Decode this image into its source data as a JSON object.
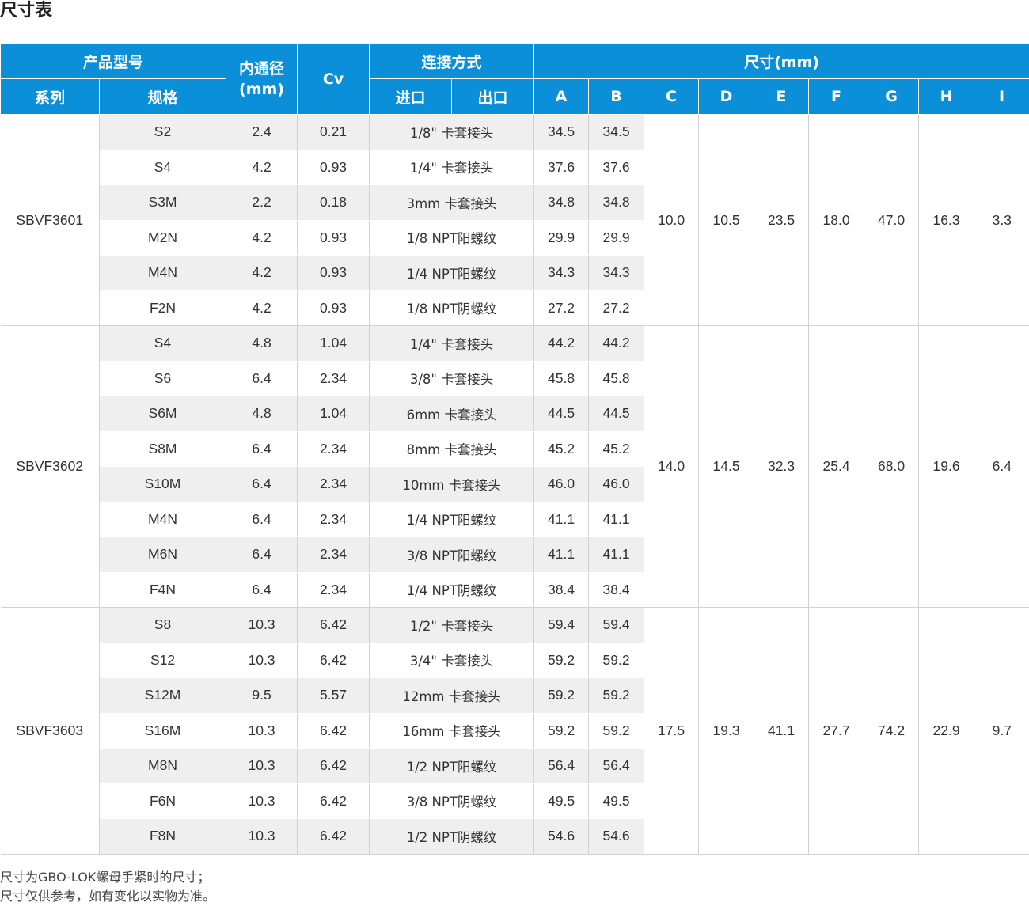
{
  "title": "尺寸表",
  "header": {
    "product_model": "产品型号",
    "series": "系列",
    "spec": "规格",
    "bore": "内通径 (mm)",
    "cv": "Cv",
    "connection": "连接方式",
    "inlet": "进口",
    "outlet": "出口",
    "dimensions": "尺寸(mm)",
    "dim_cols": [
      "A",
      "B",
      "C",
      "D",
      "E",
      "F",
      "G",
      "H",
      "I"
    ]
  },
  "groups": [
    {
      "series": "SBVF3601",
      "C": "10.0",
      "D": "10.5",
      "E": "23.5",
      "F": "18.0",
      "G": "47.0",
      "H": "16.3",
      "I": "3.3",
      "rows": [
        {
          "spec": "S2",
          "bore": "2.4",
          "cv": "0.21",
          "conn": "1/8\" 卡套接头",
          "A": "34.5",
          "B": "34.5"
        },
        {
          "spec": "S4",
          "bore": "4.2",
          "cv": "0.93",
          "conn": "1/4\" 卡套接头",
          "A": "37.6",
          "B": "37.6"
        },
        {
          "spec": "S3M",
          "bore": "2.2",
          "cv": "0.18",
          "conn": "3mm 卡套接头",
          "A": "34.8",
          "B": "34.8"
        },
        {
          "spec": "M2N",
          "bore": "4.2",
          "cv": "0.93",
          "conn": "1/8 NPT阳螺纹",
          "A": "29.9",
          "B": "29.9"
        },
        {
          "spec": "M4N",
          "bore": "4.2",
          "cv": "0.93",
          "conn": "1/4 NPT阳螺纹",
          "A": "34.3",
          "B": "34.3"
        },
        {
          "spec": "F2N",
          "bore": "4.2",
          "cv": "0.93",
          "conn": "1/8 NPT阴螺纹",
          "A": "27.2",
          "B": "27.2"
        }
      ]
    },
    {
      "series": "SBVF3602",
      "C": "14.0",
      "D": "14.5",
      "E": "32.3",
      "F": "25.4",
      "G": "68.0",
      "H": "19.6",
      "I": "6.4",
      "rows": [
        {
          "spec": "S4",
          "bore": "4.8",
          "cv": "1.04",
          "conn": "1/4\" 卡套接头",
          "A": "44.2",
          "B": "44.2"
        },
        {
          "spec": "S6",
          "bore": "6.4",
          "cv": "2.34",
          "conn": "3/8\" 卡套接头",
          "A": "45.8",
          "B": "45.8"
        },
        {
          "spec": "S6M",
          "bore": "4.8",
          "cv": "1.04",
          "conn": "6mm 卡套接头",
          "A": "44.5",
          "B": "44.5"
        },
        {
          "spec": "S8M",
          "bore": "6.4",
          "cv": "2.34",
          "conn": "8mm 卡套接头",
          "A": "45.2",
          "B": "45.2"
        },
        {
          "spec": "S10M",
          "bore": "6.4",
          "cv": "2.34",
          "conn": "10mm 卡套接头",
          "A": "46.0",
          "B": "46.0"
        },
        {
          "spec": "M4N",
          "bore": "6.4",
          "cv": "2.34",
          "conn": "1/4 NPT阳螺纹",
          "A": "41.1",
          "B": "41.1"
        },
        {
          "spec": "M6N",
          "bore": "6.4",
          "cv": "2.34",
          "conn": "3/8 NPT阳螺纹",
          "A": "41.1",
          "B": "41.1"
        },
        {
          "spec": "F4N",
          "bore": "6.4",
          "cv": "2.34",
          "conn": "1/4 NPT阴螺纹",
          "A": "38.4",
          "B": "38.4"
        }
      ]
    },
    {
      "series": "SBVF3603",
      "C": "17.5",
      "D": "19.3",
      "E": "41.1",
      "F": "27.7",
      "G": "74.2",
      "H": "22.9",
      "I": "9.7",
      "rows": [
        {
          "spec": "S8",
          "bore": "10.3",
          "cv": "6.42",
          "conn": "1/2\" 卡套接头",
          "A": "59.4",
          "B": "59.4"
        },
        {
          "spec": "S12",
          "bore": "10.3",
          "cv": "6.42",
          "conn": "3/4\" 卡套接头",
          "A": "59.2",
          "B": "59.2"
        },
        {
          "spec": "S12M",
          "bore": "9.5",
          "cv": "5.57",
          "conn": "12mm 卡套接头",
          "A": "59.2",
          "B": "59.2"
        },
        {
          "spec": "S16M",
          "bore": "10.3",
          "cv": "6.42",
          "conn": "16mm 卡套接头",
          "A": "59.2",
          "B": "59.2"
        },
        {
          "spec": "M8N",
          "bore": "10.3",
          "cv": "6.42",
          "conn": "1/2 NPT阳螺纹",
          "A": "56.4",
          "B": "56.4"
        },
        {
          "spec": "F6N",
          "bore": "10.3",
          "cv": "6.42",
          "conn": "3/8 NPT阴螺纹",
          "A": "49.5",
          "B": "49.5"
        },
        {
          "spec": "F8N",
          "bore": "10.3",
          "cv": "6.42",
          "conn": "1/2 NPT阴螺纹",
          "A": "54.6",
          "B": "54.6"
        }
      ]
    }
  ],
  "notes": [
    "尺寸为GBO-LOK螺母手紧时的尺寸；",
    "尺寸仅供参考，如有变化以实物为准。"
  ],
  "colors": {
    "header_bg": "#0b8fd8",
    "stripe_bg": "#efefef"
  }
}
